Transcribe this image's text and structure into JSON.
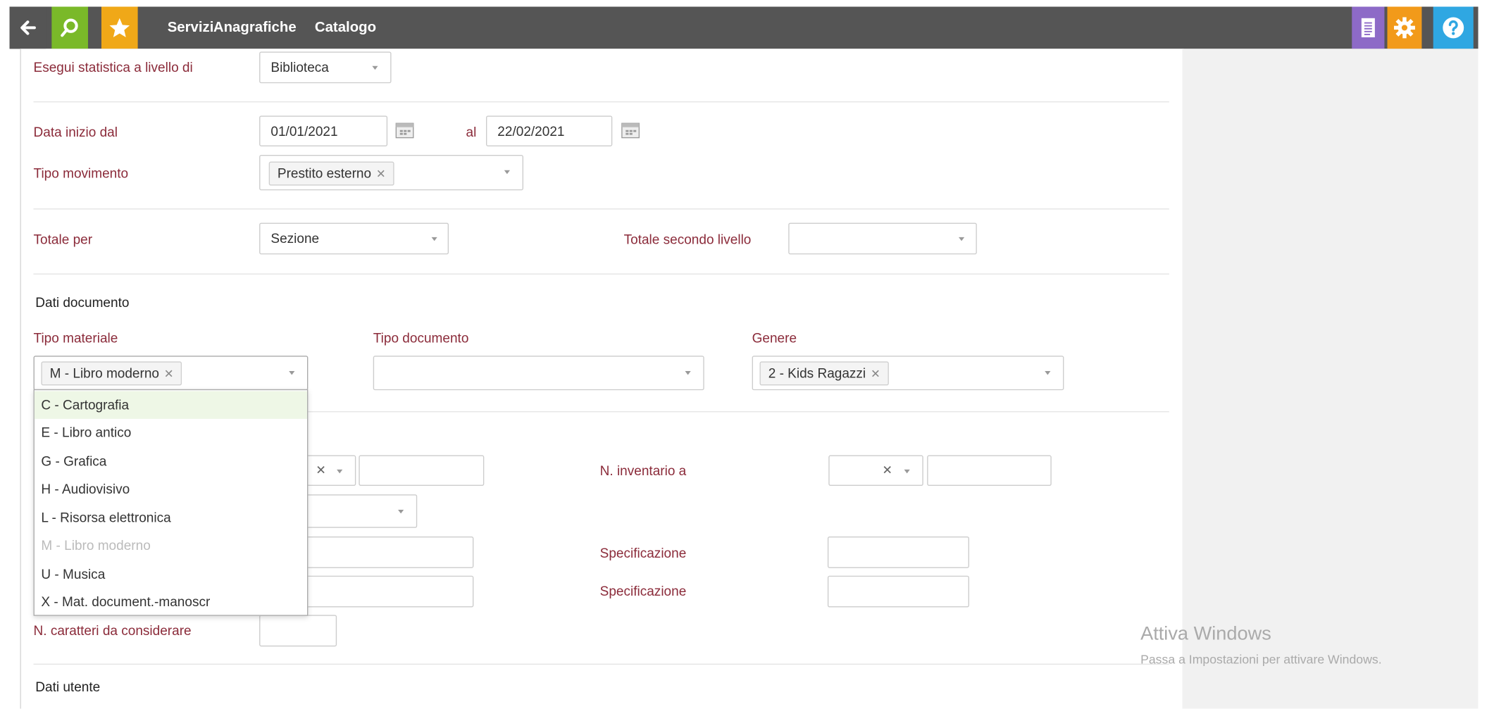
{
  "toolbar": {
    "nav": [
      "Servizi",
      "Anagrafiche",
      "Catalogo"
    ],
    "colors": {
      "bar": "#555555",
      "search": "#7ab929",
      "star": "#f0a818",
      "doc": "#8d6ac7",
      "gear": "#f29a1a",
      "help": "#2fa7e2"
    }
  },
  "form": {
    "livello": {
      "label": "Esegui statistica a livello di",
      "value": "Biblioteca"
    },
    "data_inizio": {
      "label": "Data inizio dal",
      "from": "01/01/2021",
      "to_label": "al",
      "to": "22/02/2021"
    },
    "tipo_movimento": {
      "label": "Tipo movimento",
      "chip": "Prestito esterno"
    },
    "totale_per": {
      "label": "Totale per",
      "value": "Sezione"
    },
    "totale_secondo_livello": {
      "label": "Totale secondo livello",
      "value": ""
    },
    "dati_documento": {
      "heading": "Dati documento",
      "tipo_materiale": {
        "label": "Tipo materiale",
        "chip": "M  -  Libro moderno"
      },
      "tipo_documento": {
        "label": "Tipo documento",
        "value": ""
      },
      "genere": {
        "label": "Genere",
        "chip": "2 - Kids Ragazzi"
      }
    },
    "inventario": {
      "label_a": "N. inventario a"
    },
    "specificazione": {
      "label1": "Specificazione",
      "label2": "Specificazione"
    },
    "caratteri": {
      "label": "N. caratteri da considerare"
    },
    "dati_utente": {
      "heading": "Dati utente"
    }
  },
  "dropdown": {
    "options": [
      {
        "label": "C  -  Cartografia",
        "state": "highlighted"
      },
      {
        "label": "E  -  Libro antico",
        "state": "normal"
      },
      {
        "label": "G  -  Grafica",
        "state": "normal"
      },
      {
        "label": "H  -  Audiovisivo",
        "state": "normal"
      },
      {
        "label": "L  -  Risorsa elettronica",
        "state": "normal"
      },
      {
        "label": "M  -  Libro moderno",
        "state": "disabled"
      },
      {
        "label": "U  -  Musica",
        "state": "normal"
      },
      {
        "label": "X  -  Mat. document.-manoscr",
        "state": "normal"
      }
    ]
  },
  "watermark": {
    "title": "Attiva Windows",
    "subtitle": "Passa a Impostazioni per attivare Windows."
  }
}
